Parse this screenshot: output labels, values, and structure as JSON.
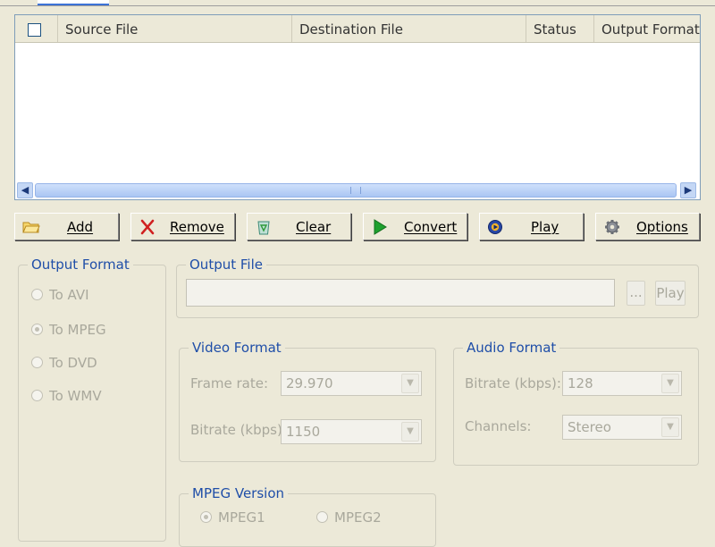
{
  "file_list": {
    "columns": [
      "Source File",
      "Destination File",
      "Status",
      "Output Format"
    ],
    "rows": []
  },
  "toolbar": {
    "add": "Add",
    "remove": "Remove",
    "clear": "Clear",
    "convert": "Convert",
    "play": "Play",
    "options": "Options"
  },
  "output_format": {
    "title": "Output Format",
    "options": [
      "To AVI",
      "To MPEG",
      "To DVD",
      "To WMV"
    ],
    "selected": "To MPEG"
  },
  "output_file": {
    "title": "Output File",
    "value": "",
    "browse_label": "...",
    "play_label": "Play"
  },
  "video_format": {
    "title": "Video Format",
    "frame_rate_label": "Frame rate:",
    "frame_rate_value": "29.970",
    "bitrate_label": "Bitrate (kbps):",
    "bitrate_value": "1150"
  },
  "audio_format": {
    "title": "Audio Format",
    "bitrate_label": "Bitrate (kbps):",
    "bitrate_value": "128",
    "channels_label": "Channels:",
    "channels_value": "Stereo"
  },
  "mpeg_version": {
    "title": "MPEG Version",
    "options": [
      "MPEG1",
      "MPEG2"
    ],
    "selected": "MPEG1"
  },
  "colors": {
    "background": "#ECE9D8",
    "group_title": "#1F4EA8",
    "disabled_text": "#A9A89C",
    "list_border": "#7F9DB9"
  }
}
